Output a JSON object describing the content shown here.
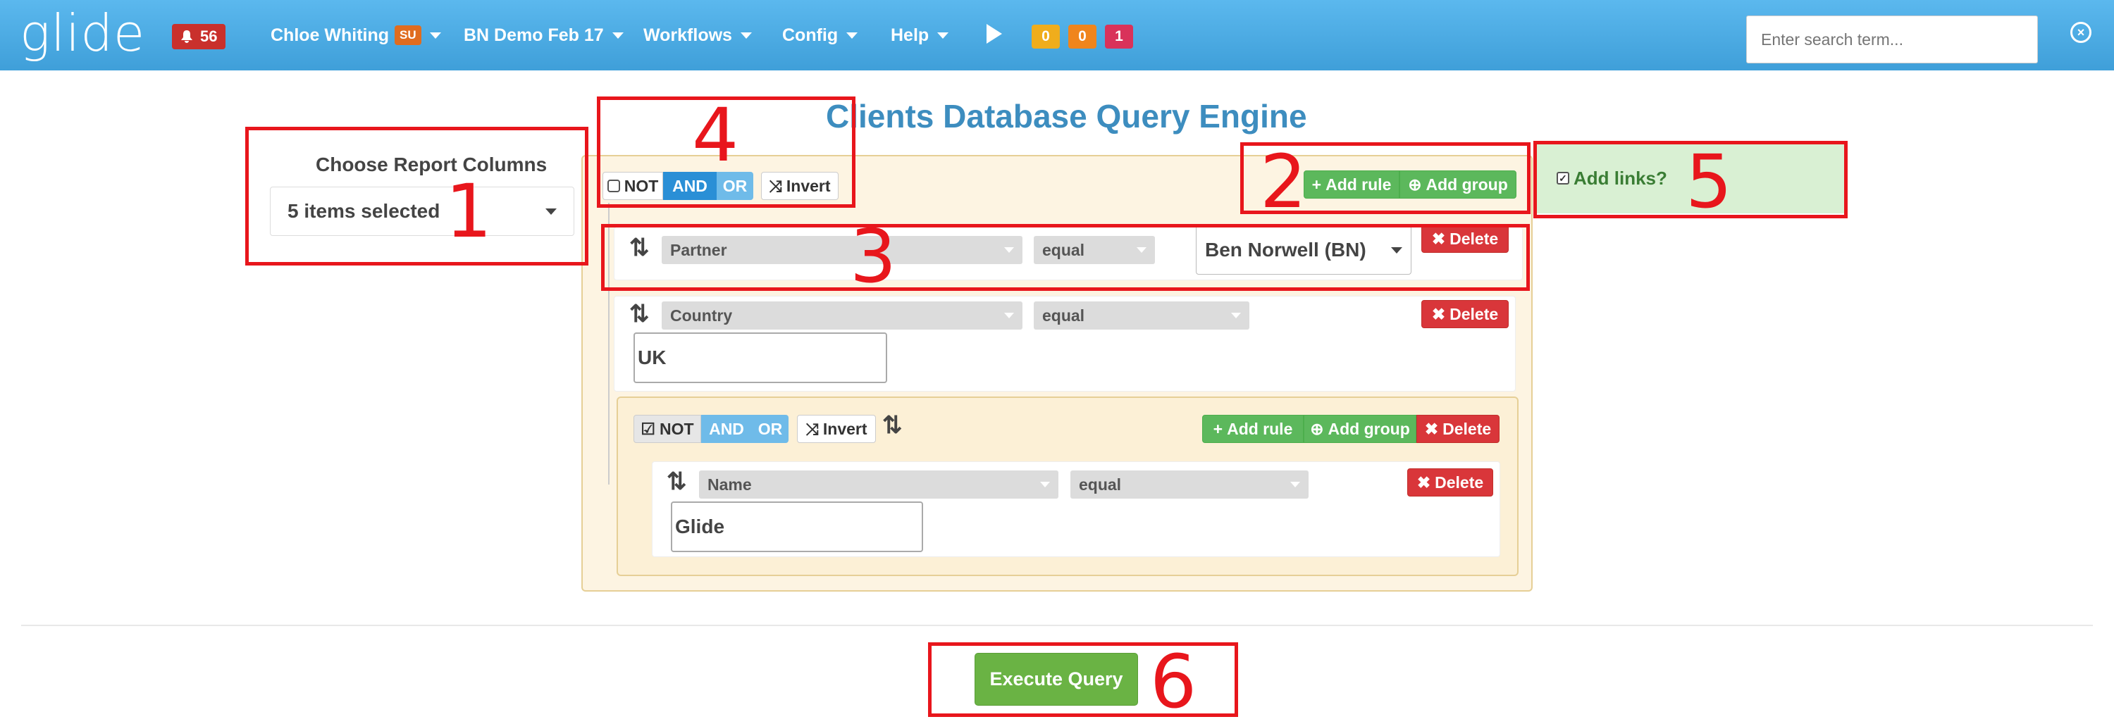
{
  "navbar": {
    "logo": "glide",
    "notifications": "56",
    "user_name": "Chloe Whiting",
    "user_badge": "SU",
    "project": "BN Demo Feb 17",
    "workflows": "Workflows",
    "config": "Config",
    "help": "Help",
    "counts": [
      {
        "value": "0",
        "color": "#f0ad1c"
      },
      {
        "value": "0",
        "color": "#f0851c"
      },
      {
        "value": "1",
        "color": "#d9325a"
      }
    ],
    "search_placeholder": "Enter search term..."
  },
  "page_title": "Clients Database Query Engine",
  "columns": {
    "label": "Choose Report Columns",
    "selected": "5 items selected"
  },
  "builder": {
    "not": "NOT",
    "and": "AND",
    "or": "OR",
    "invert": "Invert",
    "add_rule": "Add rule",
    "add_group": "Add group",
    "delete": "Delete",
    "rules": [
      {
        "field": "Partner",
        "operator": "equal",
        "value": "Ben Norwell (BN)"
      },
      {
        "field": "Country",
        "operator": "equal",
        "value": "UK"
      }
    ],
    "group": {
      "not_checked": true,
      "rule": {
        "field": "Name",
        "operator": "equal",
        "value": "Glide"
      }
    }
  },
  "add_links_label": "Add links?",
  "execute_label": "Execute Query",
  "annotations": [
    "1",
    "2",
    "3",
    "4",
    "5",
    "6"
  ]
}
